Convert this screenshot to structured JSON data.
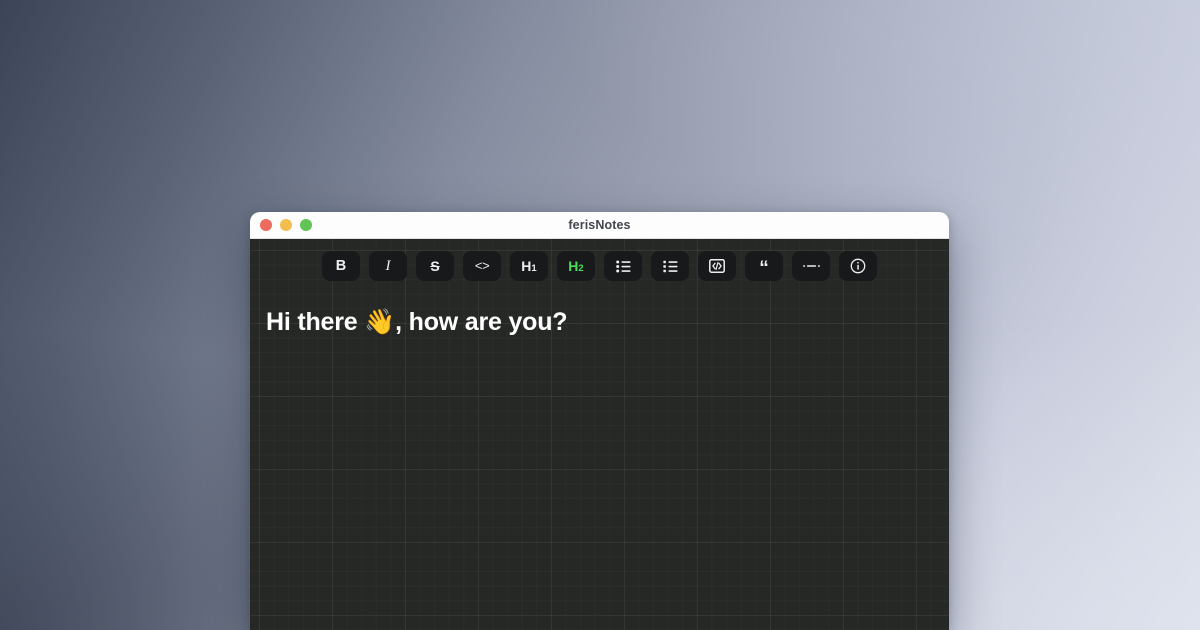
{
  "desktop": {
    "gradient_from": "#3c4458",
    "gradient_to": "#dce0ea"
  },
  "window": {
    "title": "ferisNotes",
    "traffic_lights": [
      {
        "name": "close",
        "color": "#ec6a5e"
      },
      {
        "name": "minimize",
        "color": "#f4bd4f"
      },
      {
        "name": "maximize",
        "color": "#61c454"
      }
    ]
  },
  "toolbar": {
    "active_color": "#4ade5a",
    "button_bg": "#18191a",
    "buttons": [
      {
        "id": "bold",
        "label": "B",
        "icon": "bold-icon",
        "active": false
      },
      {
        "id": "italic",
        "label": "I",
        "icon": "italic-icon",
        "active": false
      },
      {
        "id": "strikethrough",
        "label": "S",
        "icon": "strikethrough-icon",
        "active": false
      },
      {
        "id": "inline-code",
        "label": "<>",
        "icon": "inline-code-icon",
        "active": false
      },
      {
        "id": "heading-1",
        "label": "H1",
        "icon": "heading-1-icon",
        "active": false
      },
      {
        "id": "heading-2",
        "label": "H2",
        "icon": "heading-2-icon",
        "active": true
      },
      {
        "id": "bullet-list",
        "label": "",
        "icon": "bullet-list-icon",
        "active": false
      },
      {
        "id": "ordered-list",
        "label": "",
        "icon": "ordered-list-icon",
        "active": false
      },
      {
        "id": "code-block",
        "label": "",
        "icon": "code-block-icon",
        "active": false
      },
      {
        "id": "blockquote",
        "label": "“",
        "icon": "blockquote-icon",
        "active": false
      },
      {
        "id": "horizontal-rule",
        "label": "",
        "icon": "horizontal-rule-icon",
        "active": false
      },
      {
        "id": "info",
        "label": "",
        "icon": "info-icon",
        "active": false
      }
    ]
  },
  "document": {
    "heading": "Hi there 👋, how are you?",
    "background": "#262826",
    "text_color": "#ffffff"
  }
}
